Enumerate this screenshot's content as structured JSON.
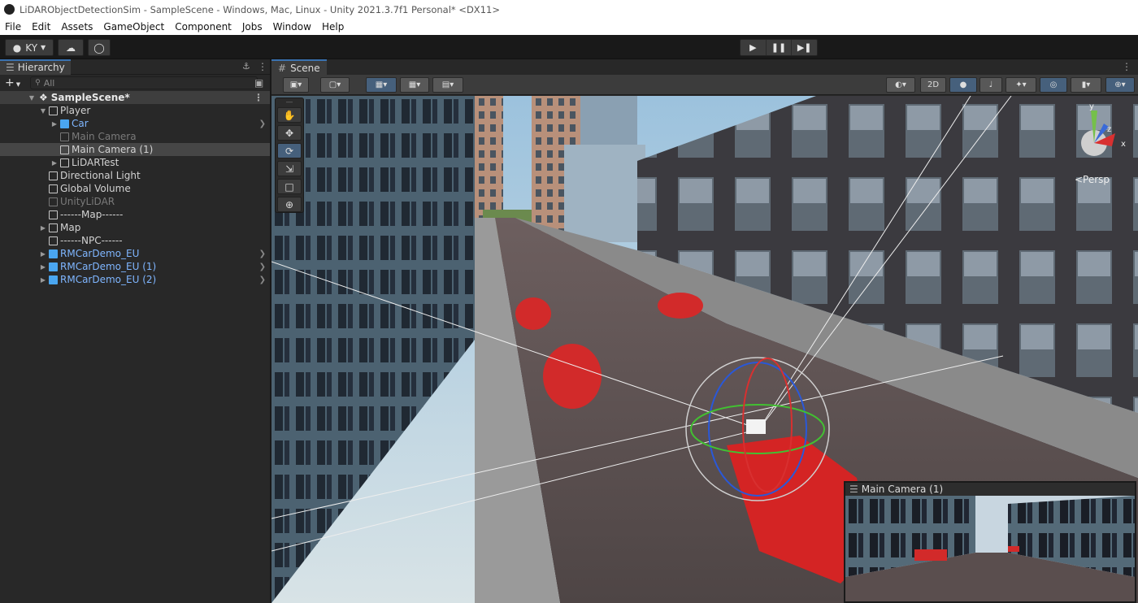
{
  "window": {
    "title": "LiDARObjectDetectionSim - SampleScene - Windows, Mac, Linux - Unity 2021.3.7f1 Personal* <DX11>"
  },
  "menu": [
    "File",
    "Edit",
    "Assets",
    "GameObject",
    "Component",
    "Jobs",
    "Window",
    "Help"
  ],
  "toolbar": {
    "account": "KY",
    "play_icon": "play-icon",
    "pause_icon": "pause-icon",
    "step_icon": "step-icon"
  },
  "hierarchy": {
    "tab_label": "Hierarchy",
    "search_placeholder": "All",
    "scene_name": "SampleScene*",
    "items": [
      {
        "label": "Player",
        "depth": 1,
        "expanded": true,
        "type": "object"
      },
      {
        "label": "Car",
        "depth": 2,
        "expanded": false,
        "type": "prefab"
      },
      {
        "label": "Main Camera",
        "depth": 2,
        "type": "disabled"
      },
      {
        "label": "Main Camera (1)",
        "depth": 2,
        "type": "object",
        "selected": true
      },
      {
        "label": "LiDARTest",
        "depth": 2,
        "expanded": false,
        "type": "object"
      },
      {
        "label": "Directional Light",
        "depth": 1,
        "type": "object"
      },
      {
        "label": "Global Volume",
        "depth": 1,
        "type": "object"
      },
      {
        "label": "UnityLiDAR",
        "depth": 1,
        "type": "disabled"
      },
      {
        "label": "------Map------",
        "depth": 1,
        "type": "object"
      },
      {
        "label": "Map",
        "depth": 1,
        "expanded": false,
        "type": "object"
      },
      {
        "label": "------NPC------",
        "depth": 1,
        "type": "object"
      },
      {
        "label": "RMCarDemo_EU",
        "depth": 1,
        "expanded": false,
        "type": "prefab"
      },
      {
        "label": "RMCarDemo_EU (1)",
        "depth": 1,
        "expanded": false,
        "type": "prefab"
      },
      {
        "label": "RMCarDemo_EU (2)",
        "depth": 1,
        "expanded": false,
        "type": "prefab"
      }
    ]
  },
  "scene": {
    "tab_label": "Scene",
    "toggle_2d": "2D",
    "persp_label": "<Persp",
    "camera_preview_title": "Main Camera (1)",
    "gizmo_axes": {
      "x": "x",
      "y": "y",
      "z": "z"
    }
  }
}
